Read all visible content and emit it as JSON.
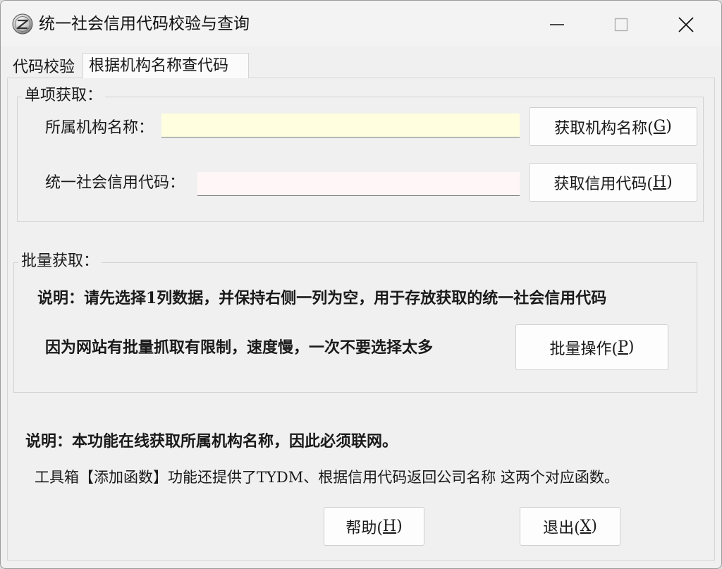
{
  "window": {
    "title": "统一社会信用代码校验与查询",
    "controls": {
      "minimize": "minimize-icon",
      "maximize": "maximize-icon",
      "close": "close-icon"
    }
  },
  "tabs": [
    {
      "label": "代码校验"
    },
    {
      "label": "根据机构名称查代码"
    }
  ],
  "single": {
    "legend": "单项获取：",
    "org_label": "所属机构名称：",
    "org_value": "",
    "code_label": "统一社会信用代码：",
    "code_value": "",
    "get_name_btn": {
      "text": "获取机构名称(",
      "key": "G",
      "end": ")"
    },
    "get_code_btn": {
      "text": "获取信用代码(",
      "key": "H",
      "end": ")"
    }
  },
  "batch": {
    "legend": "批量获取：",
    "note1": "说明：请先选择1列数据，并保持右侧一列为空，用于存放获取的统一社会信用代码",
    "note2": "因为网站有批量抓取有限制，速度慢，一次不要选择太多",
    "batch_btn": {
      "text": "批量操作(",
      "key": "P",
      "end": ")"
    }
  },
  "footer": {
    "note1": "说明：本功能在线获取所属机构名称，因此必须联网。",
    "note2": "工具箱【添加函数】功能还提供了TYDM、根据信用代码返回公司名称 这两个对应函数。",
    "help_btn": {
      "text": "帮助(",
      "key": "H",
      "end": ")"
    },
    "exit_btn": {
      "text": "退出(",
      "key": "X",
      "end": ")"
    }
  },
  "colors": {
    "org_input_bg": "#ffffe0",
    "code_input_bg": "#fff7f7",
    "window_bg": "#f0f0f0"
  }
}
